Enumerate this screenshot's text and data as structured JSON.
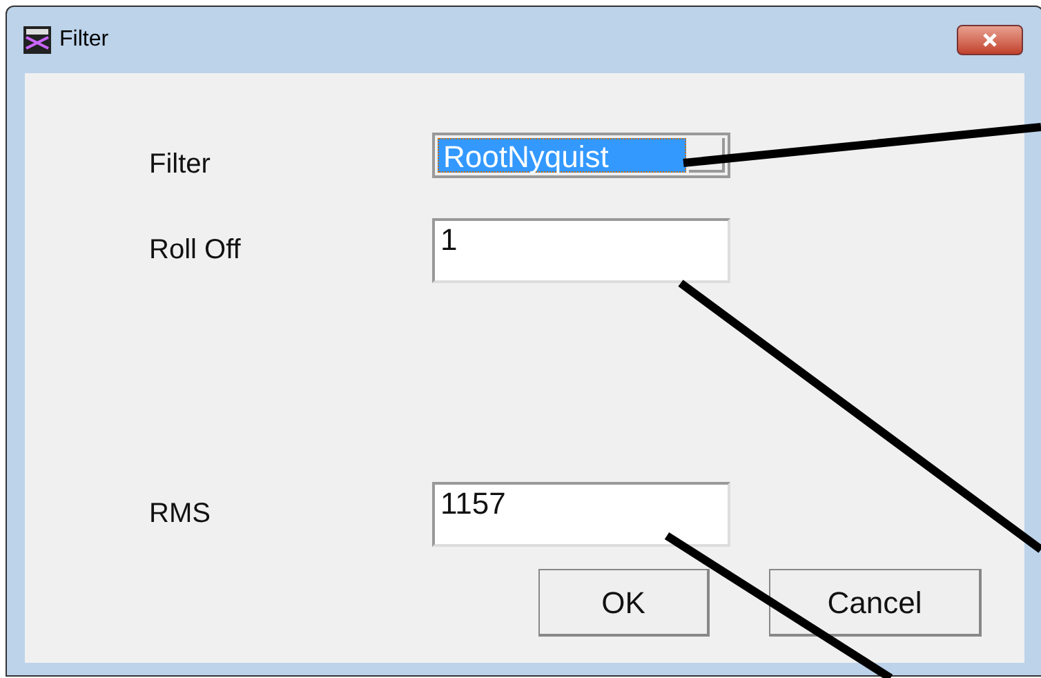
{
  "window": {
    "title": "Filter"
  },
  "fields": [
    {
      "kind": "dropdown",
      "label": "Filter",
      "value": "RootNyquist"
    },
    {
      "kind": "text",
      "label": "Roll Off",
      "value": "1"
    },
    {
      "kind": "text",
      "label": "RMS",
      "value": "1157"
    }
  ],
  "buttons": [
    "OK",
    "Cancel"
  ]
}
